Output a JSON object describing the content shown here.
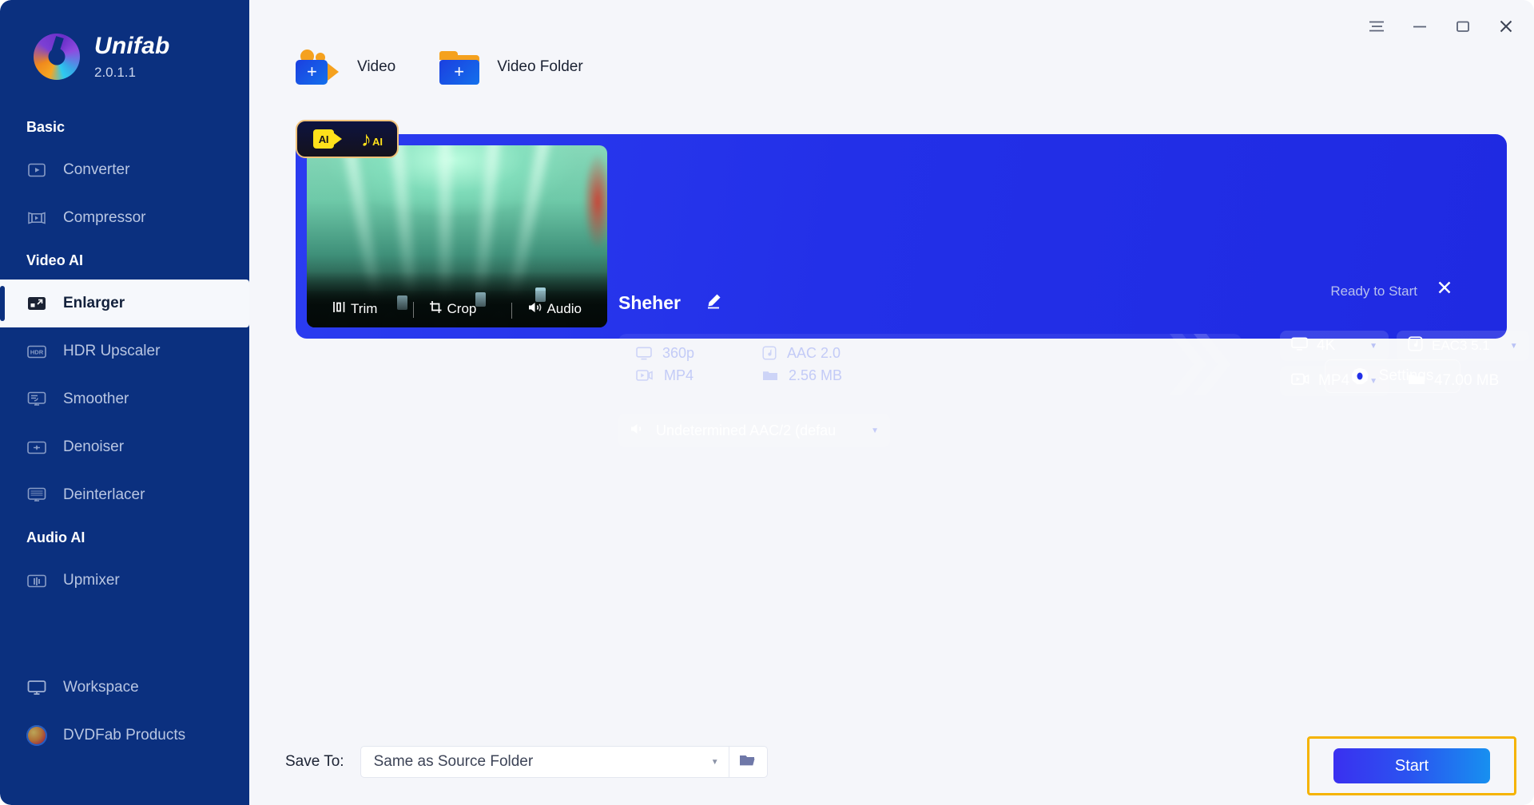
{
  "app": {
    "name": "Unifab",
    "version": "2.0.1.1",
    "logo_icon": "unifab-swirl-logo",
    "accent_blue": "#2330e8",
    "sidebar_blue": "#0b307f",
    "highlight_gold": "#f5b301"
  },
  "window_controls": {
    "menu_icon": "hamburger-menu-icon",
    "minimize_icon": "minimize-icon",
    "maximize_icon": "maximize-icon",
    "close_icon": "close-icon"
  },
  "sidebar": {
    "groups": [
      {
        "label": "Basic",
        "items": [
          {
            "label": "Converter",
            "icon": "video-convert-icon",
            "active": false
          },
          {
            "label": "Compressor",
            "icon": "video-compress-icon",
            "active": false
          }
        ]
      },
      {
        "label": "Video AI",
        "items": [
          {
            "label": "Enlarger",
            "icon": "enlarge-icon",
            "active": true
          },
          {
            "label": "HDR Upscaler",
            "icon": "hdr-icon",
            "active": false
          },
          {
            "label": "Smoother",
            "icon": "smoother-icon",
            "active": false
          },
          {
            "label": "Denoiser",
            "icon": "denoiser-icon",
            "active": false
          },
          {
            "label": "Deinterlacer",
            "icon": "deinterlacer-icon",
            "active": false
          }
        ]
      },
      {
        "label": "Audio AI",
        "items": [
          {
            "label": "Upmixer",
            "icon": "upmixer-icon",
            "active": false
          }
        ]
      }
    ],
    "bottom_items": [
      {
        "label": "Workspace",
        "icon": "monitor-icon"
      },
      {
        "label": "DVDFab Products",
        "icon": "dvdfab-logo-icon"
      }
    ]
  },
  "toolbar": {
    "add_video_label": "Video",
    "add_video_icon": "add-video-camera-icon",
    "add_folder_label": "Video Folder",
    "add_folder_icon": "add-video-folder-icon"
  },
  "task": {
    "title": "Sheher",
    "edit_icon": "pencil-edit-icon",
    "status": "Ready to Start",
    "close_icon": "remove-task-icon",
    "ai_badge": {
      "video_ai_label": "AI",
      "audio_ai_label": "AI",
      "video_icon": "ai-video-camera-icon",
      "audio_icon": "ai-music-note-icon"
    },
    "thumb_tools": [
      {
        "label": "Trim",
        "icon": "trim-icon"
      },
      {
        "label": "Crop",
        "icon": "crop-icon"
      },
      {
        "label": "Audio",
        "icon": "speaker-icon"
      }
    ],
    "source": {
      "resolution": "360p",
      "resolution_icon": "monitor-icon",
      "format": "MP4",
      "format_icon": "video-file-icon",
      "audio_codec": "AAC 2.0",
      "audio_icon": "music-note-icon",
      "size": "2.56 MB",
      "size_icon": "folder-icon"
    },
    "output": {
      "resolution": "4K",
      "resolution_icon": "monitor-icon",
      "format": "MP4",
      "format_icon": "video-file-icon",
      "audio_codec": "EAC3 5.1",
      "audio_icon": "music-note-icon",
      "size": "47.00 MB",
      "size_icon": "folder-icon",
      "caret_icon": "chevron-down-icon"
    },
    "audio_track": {
      "value": "Undetermined AAC/2 (defau",
      "icon": "speaker-icon",
      "caret_icon": "chevron-down-icon"
    },
    "settings_label": "Settings",
    "settings_icon": "gear-icon"
  },
  "bottom": {
    "save_to_label": "Save To:",
    "save_to_value": "Same as Source Folder",
    "save_to_placeholder": "Same as Source Folder",
    "save_caret_icon": "chevron-down-icon",
    "browse_icon": "folder-open-icon",
    "start_label": "Start"
  }
}
